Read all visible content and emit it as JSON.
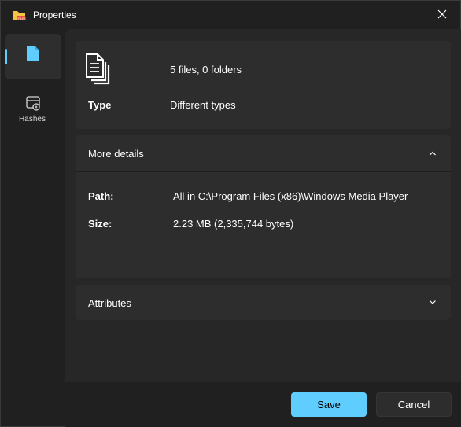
{
  "window": {
    "title": "Properties",
    "app_icon": "folder-app-icon",
    "close_icon": "close-icon"
  },
  "sidebar": {
    "items": [
      {
        "label": "",
        "icon": "file-icon",
        "active": true
      },
      {
        "label": "Hashes",
        "icon": "hash-icon",
        "active": false
      }
    ]
  },
  "summary": {
    "icon": "files-icon",
    "count_text": "5 files, 0 folders",
    "type_label": "Type",
    "type_value": "Different types"
  },
  "details": {
    "header": "More details",
    "expanded": true,
    "path_label": "Path:",
    "path_value": "All in C:\\Program Files (x86)\\Windows Media Player",
    "size_label": "Size:",
    "size_value": "2.23 MB (2,335,744 bytes)"
  },
  "attributes": {
    "header": "Attributes",
    "expanded": false
  },
  "footer": {
    "save_label": "Save",
    "cancel_label": "Cancel"
  },
  "colors": {
    "accent": "#60cdff",
    "background": "#202020",
    "panel": "#272727",
    "card": "#2d2d2d"
  }
}
